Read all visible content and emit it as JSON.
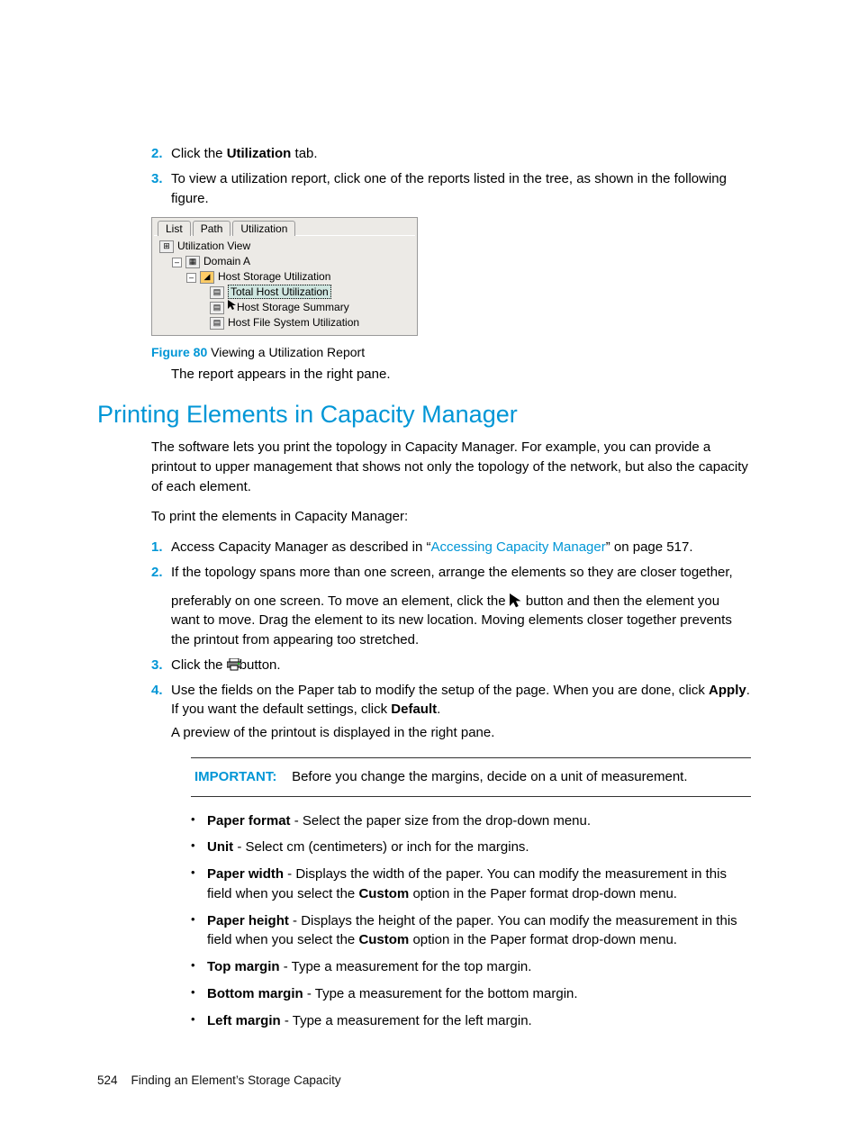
{
  "steps_a": [
    {
      "num": "2.",
      "pre": "Click the ",
      "bold": "Utilization",
      "post": " tab."
    },
    {
      "num": "3.",
      "text": "To view a utilization report, click one of the reports listed in the tree, as shown in the following figure."
    }
  ],
  "figure": {
    "tabs": [
      "List",
      "Path",
      "Utilization"
    ],
    "tree": {
      "root": "Utilization View",
      "domain": "Domain A",
      "group": "Host Storage Utilization",
      "item_selected": "Total Host Utilization",
      "item2": "Host Storage Summary",
      "item3": "Host File System Utilization"
    },
    "caption_label": "Figure 80",
    "caption_text": "Viewing a Utilization Report"
  },
  "after_figure": "The report appears in the right pane.",
  "section_title": "Printing Elements in Capacity Manager",
  "intro": "The software lets you print the topology in Capacity Manager. For example, you can provide a printout to upper management that shows not only the topology of the network, but also the capacity of each element.",
  "intro2": "To print the elements in Capacity Manager:",
  "steps_b": {
    "s1": {
      "num": "1.",
      "pre": "Access Capacity Manager as described in “",
      "link": "Accessing Capacity Manager",
      "post": "” on page 517."
    },
    "s2": {
      "num": "2.",
      "line1": "If the topology spans more than one screen, arrange the elements so they are closer together,",
      "line2a": "preferably on one screen. To move an element, click the ",
      "line2b": " button and then the element you want to move. Drag the element to its new location. Moving elements closer together prevents the printout from appearing too stretched."
    },
    "s3": {
      "num": "3.",
      "pre": "Click the ",
      "post": "button."
    },
    "s4": {
      "num": "4.",
      "line1a": "Use the fields on the Paper tab to modify the setup of the page. When you are done, click ",
      "bold1": "Apply",
      "mid": ". If you want the default settings, click ",
      "bold2": "Default",
      "end": ".",
      "line2": "A preview of the printout is displayed in the right pane."
    }
  },
  "important": {
    "label": "IMPORTANT:",
    "text": "Before you change the margins, decide on a unit of measurement."
  },
  "bullets": [
    {
      "b": "Paper format",
      "t": " - Select the paper size from the drop-down menu."
    },
    {
      "b": "Unit",
      "t": " - Select cm (centimeters) or inch for the margins."
    },
    {
      "b": "Paper width",
      "t": " - Displays the width of the paper. You can modify the measurement in this field when you select the ",
      "b2": "Custom",
      "t2": " option in the Paper format drop-down menu."
    },
    {
      "b": "Paper height",
      "t": " - Displays the height of the paper. You can modify the measurement in this field when you select the ",
      "b2": "Custom",
      "t2": " option in the Paper format drop-down menu."
    },
    {
      "b": "Top margin",
      "t": " - Type a measurement for the top margin."
    },
    {
      "b": "Bottom margin",
      "t": " - Type a measurement for the bottom margin."
    },
    {
      "b": "Left margin",
      "t": " - Type a measurement for the left margin."
    }
  ],
  "footer": {
    "page": "524",
    "title": "Finding an Element’s Storage Capacity"
  }
}
